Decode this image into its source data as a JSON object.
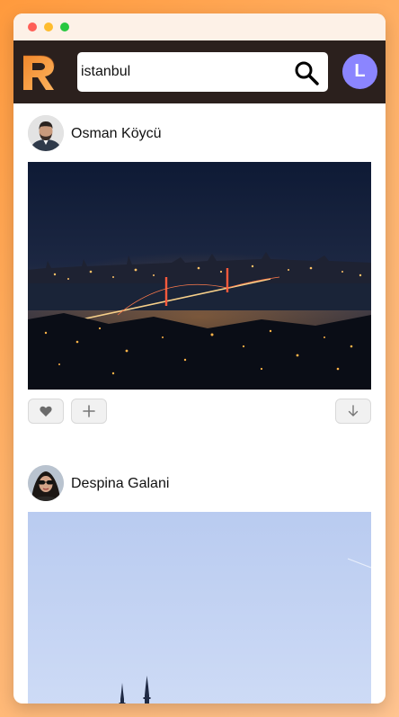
{
  "app": {
    "logo_icon": "r-logo-icon",
    "accent_gradient": [
      "#f29135",
      "#ffb25c"
    ]
  },
  "window": {
    "titlebar_color": "#fdf1e7",
    "controls": [
      "close",
      "minimize",
      "zoom"
    ]
  },
  "header": {
    "background": "#2b201d",
    "search": {
      "value": "istanbul",
      "icon": "search-icon"
    },
    "user_avatar": {
      "initial": "L",
      "color": "#8b85ff"
    }
  },
  "posts": [
    {
      "author": "Osman Köycü",
      "image": "night skyline of istanbul with illuminated bridge",
      "actions": [
        "heart-icon",
        "plus-icon",
        "download-icon"
      ]
    },
    {
      "author": "Despina Galani",
      "image": "minarets under a pale blue sky"
    }
  ]
}
